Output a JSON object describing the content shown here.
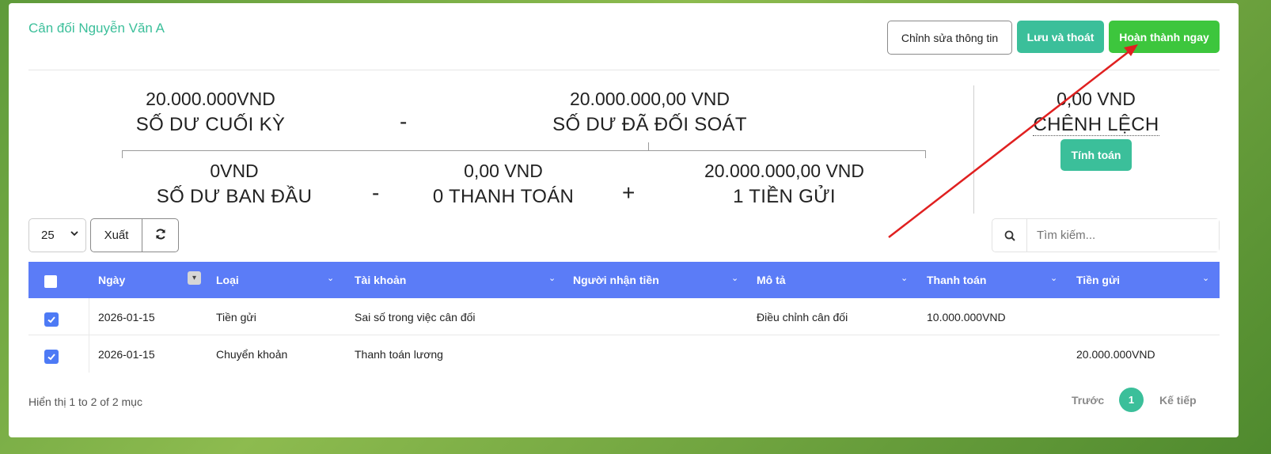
{
  "header": {
    "title": "Cân đối Nguyễn Văn A",
    "edit_label": "Chỉnh sửa thông tin",
    "save_label": "Lưu và thoát",
    "done_label": "Hoàn thành ngay"
  },
  "summary": {
    "ending_balance": {
      "amount": "20.000.000VND",
      "label": "SỐ DƯ CUỐI KỲ"
    },
    "reconciled_balance": {
      "amount": "20.000.000,00 VND",
      "label": "SỐ DƯ ĐÃ ĐỐI SOÁT"
    },
    "difference": {
      "amount": "0,00 VND",
      "label": "CHÊNH LỆCH"
    },
    "opening_balance": {
      "amount": "0VND",
      "label": "SỐ DƯ BAN ĐẦU"
    },
    "payments": {
      "amount": "0,00 VND",
      "label": "0 THANH TOÁN"
    },
    "deposits": {
      "amount": "20.000.000,00 VND",
      "label": "1 TIỀN GỬI"
    },
    "op_minus": "-",
    "op_minus2": "-",
    "op_plus": "+",
    "calc_label": "Tính toán"
  },
  "toolbar": {
    "page_size": "25",
    "export_label": "Xuất",
    "search_placeholder": "Tìm kiếm..."
  },
  "table": {
    "columns": [
      "Ngày",
      "Loại",
      "Tài khoản",
      "Người nhận tiền",
      "Mô tả",
      "Thanh toán",
      "Tiền gửi"
    ],
    "rows": [
      {
        "date": "2026-01-15",
        "type": "Tiền gửi",
        "account": "Sai số trong việc cân đối",
        "payee": "",
        "desc": "Điều chỉnh cân đối",
        "payment": "10.000.000VND",
        "deposit": ""
      },
      {
        "date": "2026-01-15",
        "type": "Chuyển khoản",
        "account": "Thanh toán lương",
        "payee": "",
        "desc": "",
        "payment": "",
        "deposit": "20.000.000VND"
      }
    ]
  },
  "footer": {
    "info": "Hiển thị 1 to 2 of 2 mục",
    "prev": "Trước",
    "page": "1",
    "next": "Kế tiếp"
  },
  "colors": {
    "accent": "#3bbf9a",
    "done": "#3dc63d",
    "table_header": "#5b7cf7",
    "annotation_arrow": "#e02020"
  }
}
